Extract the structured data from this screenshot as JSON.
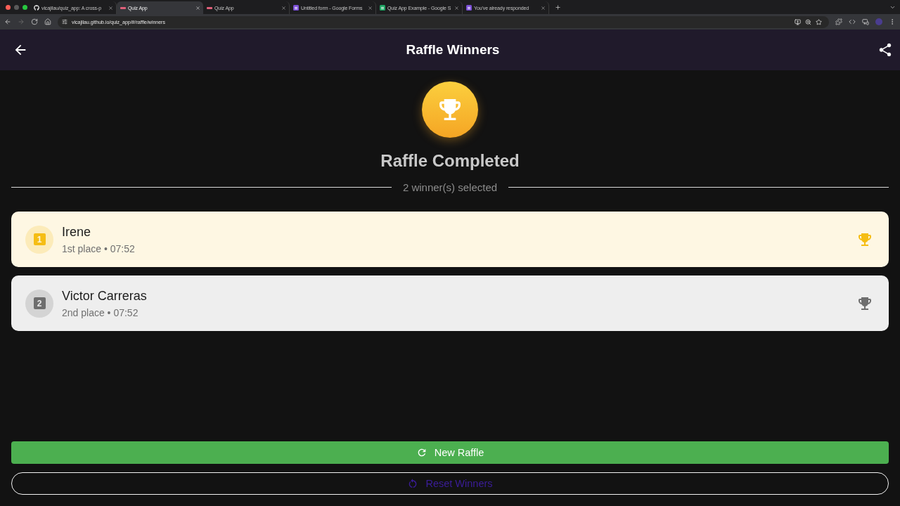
{
  "browser": {
    "tabs": [
      {
        "kind": "github",
        "title": "vicajilau/quiz_app: A cross-p",
        "selected": false
      },
      {
        "kind": "app",
        "title": "Quiz App",
        "selected": true
      },
      {
        "kind": "app",
        "title": "Quiz App",
        "selected": false
      },
      {
        "kind": "forms",
        "title": "Untitled form - Google Forms",
        "selected": false
      },
      {
        "kind": "sheets",
        "title": "Quiz App Example - Google S",
        "selected": false
      },
      {
        "kind": "forms",
        "title": "You've already responded",
        "selected": false
      }
    ],
    "address": "vicajilau.github.io/quiz_app/#/raffle/winners"
  },
  "app_bar": {
    "title": "Raffle Winners"
  },
  "summary": {
    "heading": "Raffle Completed",
    "count_label": "2 winner(s) selected"
  },
  "winners": [
    {
      "rank": "1",
      "name": "Irene",
      "detail": "1st place • 07:52",
      "color": "#f5bd14"
    },
    {
      "rank": "2",
      "name": "Victor Carreras",
      "detail": "2nd place • 07:52",
      "color": "#6e6e6e"
    }
  ],
  "actions": [
    {
      "kind": "filled",
      "label": "New Raffle"
    },
    {
      "kind": "outlined",
      "label": "Reset Winners"
    }
  ]
}
